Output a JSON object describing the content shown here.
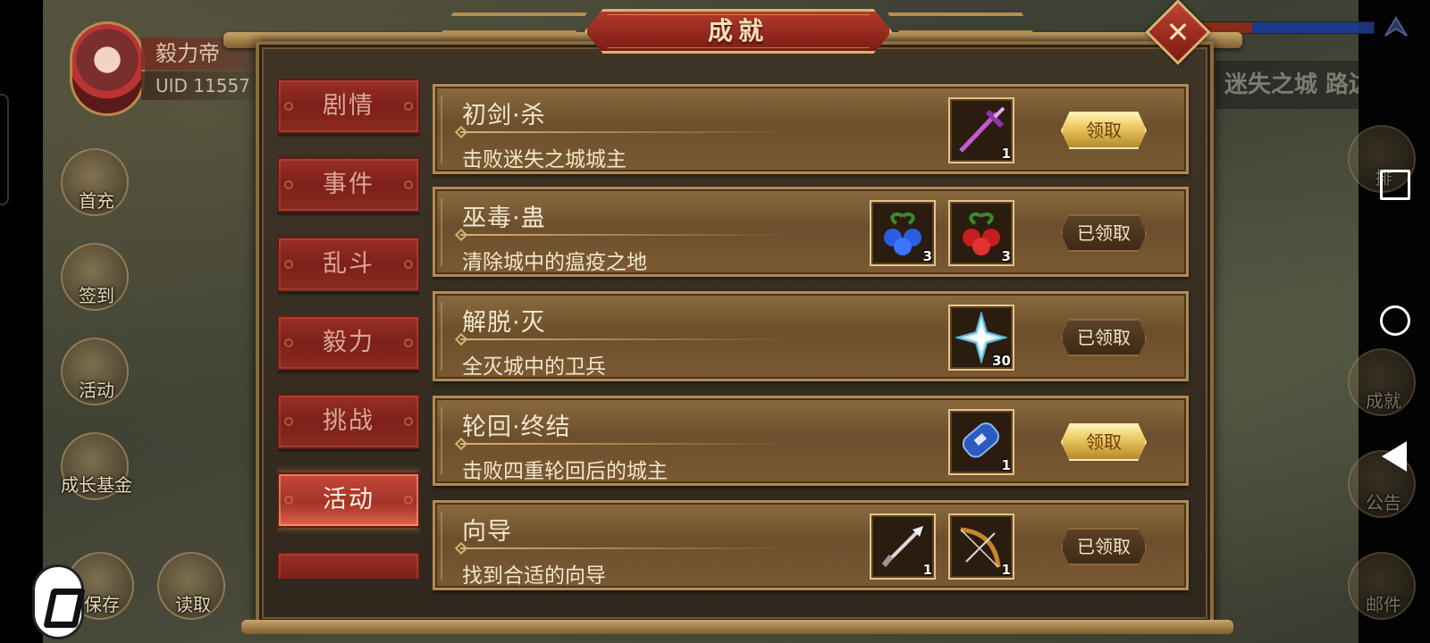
{
  "player": {
    "name": "毅力帝",
    "uid": "UID  11557"
  },
  "location": "迷失之城 路边",
  "side_buttons": [
    "首充",
    "签到",
    "活动",
    "成长基金",
    "保存",
    "读取"
  ],
  "right_buttons": [
    "排",
    "成就",
    "公告",
    "邮件"
  ],
  "dialog": {
    "title": "成就",
    "close_label": "✕",
    "tabs": [
      {
        "label": "剧情",
        "active": false
      },
      {
        "label": "事件",
        "active": false
      },
      {
        "label": "乱斗",
        "active": false
      },
      {
        "label": "毅力",
        "active": false
      },
      {
        "label": "挑战",
        "active": false
      },
      {
        "label": "活动",
        "active": true
      }
    ],
    "achievements": [
      {
        "title": "初剑·杀",
        "desc": "击败迷失之城城主",
        "rewards": [
          {
            "icon": "purple-sword-icon",
            "count": "1"
          }
        ],
        "button": "领取",
        "status": "claimable"
      },
      {
        "title": "巫毒·蛊",
        "desc": "清除城中的瘟疫之地",
        "rewards": [
          {
            "icon": "blue-berry-icon",
            "count": "3"
          },
          {
            "icon": "red-berry-icon",
            "count": "3"
          }
        ],
        "button": "已领取",
        "status": "claimed"
      },
      {
        "title": "解脱·灭",
        "desc": "全灭城中的卫兵",
        "rewards": [
          {
            "icon": "ice-crystal-icon",
            "count": "30"
          }
        ],
        "button": "已领取",
        "status": "claimed"
      },
      {
        "title": "轮回·终结",
        "desc": "击败四重轮回后的城主",
        "rewards": [
          {
            "icon": "blue-scroll-icon",
            "count": "1"
          }
        ],
        "button": "领取",
        "status": "claimable"
      },
      {
        "title": "向导",
        "desc": "找到合适的向导",
        "rewards": [
          {
            "icon": "arrow-icon",
            "count": "1"
          },
          {
            "icon": "bow-icon",
            "count": "1"
          }
        ],
        "button": "已领取",
        "status": "claimed"
      }
    ]
  },
  "colors": {
    "claim_button": "#e8c45c",
    "claimed_button": "#3e2a16",
    "tab_active": "#c8483a",
    "tab_inactive": "#7d2019"
  }
}
